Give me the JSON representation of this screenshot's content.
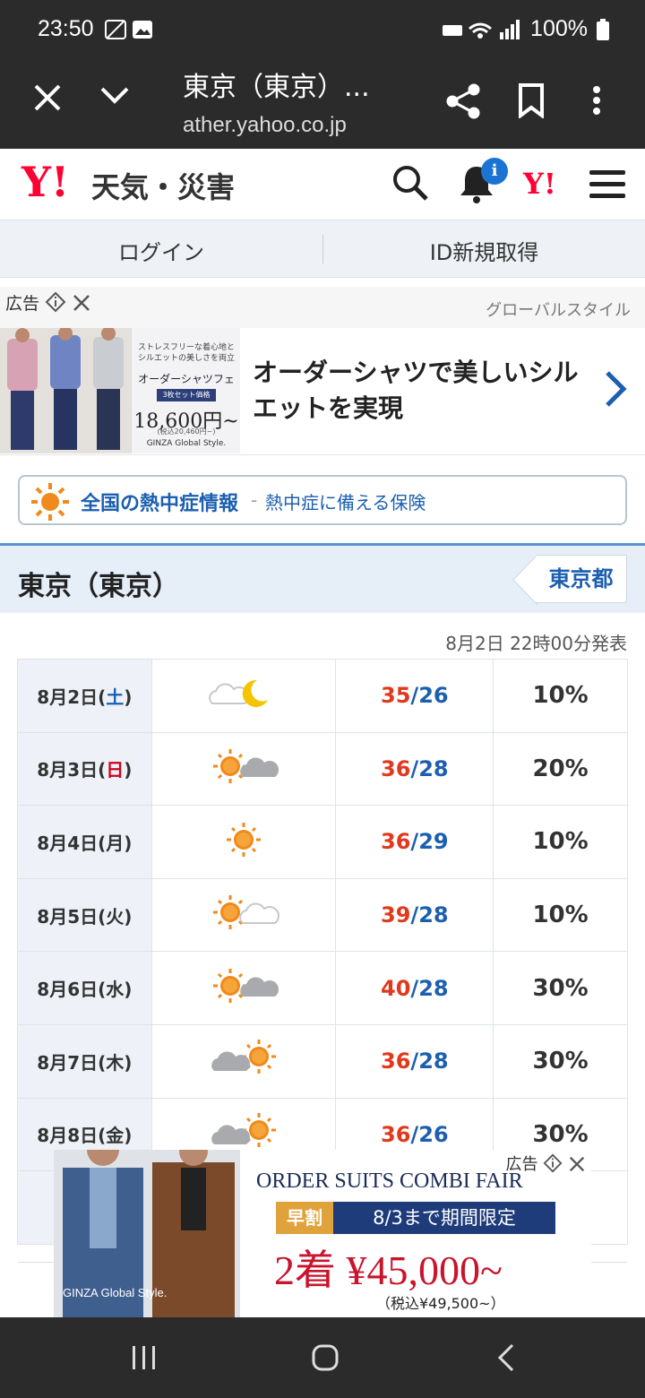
{
  "status": {
    "time": "23:50",
    "battery": "100%"
  },
  "browser": {
    "title": "東京（東京）...",
    "url": "ather.yahoo.co.jp"
  },
  "header": {
    "logo_y": "Y!",
    "logo_text": "天気・災害",
    "badge": "i",
    "right_y": "Y!"
  },
  "login": {
    "login": "ログイン",
    "register": "ID新規取得"
  },
  "ad1": {
    "label": "広告",
    "brand": "グローバルスタイル",
    "text": "オーダーシャツで美しいシルエットを実現",
    "img_line1": "ストレスフリーな着心地とシルエットの美しさを両立",
    "img_line2": "オーダーシャツフェア",
    "img_line3": "3枚セット価格",
    "img_price": "18,600円~",
    "img_tax": "(税込20,460円~)",
    "img_brand": "GINZA Global Style."
  },
  "heat": {
    "title": "全国の熱中症情報",
    "dash": "-",
    "subtitle": "熱中症に備える保険"
  },
  "location": {
    "name": "東京（東京）",
    "prefecture": "東京都"
  },
  "issued": "8月2日 22時00分発表",
  "forecast": [
    {
      "date_pre": "8月2日(",
      "dow": "土",
      "date_post": ")",
      "dow_class": "sat",
      "icon": "cloud-moon-icon",
      "high": "35",
      "low": "26",
      "precip": "10%"
    },
    {
      "date_pre": "8月3日(",
      "dow": "日",
      "date_post": ")",
      "dow_class": "sun",
      "icon": "sun-cloud-icon",
      "high": "36",
      "low": "28",
      "precip": "20%"
    },
    {
      "date_pre": "8月4日(",
      "dow": "月",
      "date_post": ")",
      "dow_class": "",
      "icon": "sun-icon",
      "high": "36",
      "low": "29",
      "precip": "10%"
    },
    {
      "date_pre": "8月5日(",
      "dow": "火",
      "date_post": ")",
      "dow_class": "",
      "icon": "sun-lightcloud-icon",
      "high": "39",
      "low": "28",
      "precip": "10%"
    },
    {
      "date_pre": "8月6日(",
      "dow": "水",
      "date_post": ")",
      "dow_class": "",
      "icon": "sun-cloud-icon",
      "high": "40",
      "low": "28",
      "precip": "30%"
    },
    {
      "date_pre": "8月7日(",
      "dow": "木",
      "date_post": ")",
      "dow_class": "",
      "icon": "cloud-sun-icon",
      "high": "36",
      "low": "28",
      "precip": "30%"
    },
    {
      "date_pre": "8月8日(",
      "dow": "金",
      "date_post": ")",
      "dow_class": "",
      "icon": "cloud-sun-icon",
      "high": "36",
      "low": "26",
      "precip": "30%"
    }
  ],
  "ad2": {
    "label": "広告",
    "img_brand": "GINZA Global Style.",
    "headline": "ORDER SUITS COMBI FAIR",
    "badge": "早割",
    "limit": "8/3まで期間限定",
    "price": "2着 ¥45,000~",
    "tax": "（税込¥49,500~）"
  }
}
